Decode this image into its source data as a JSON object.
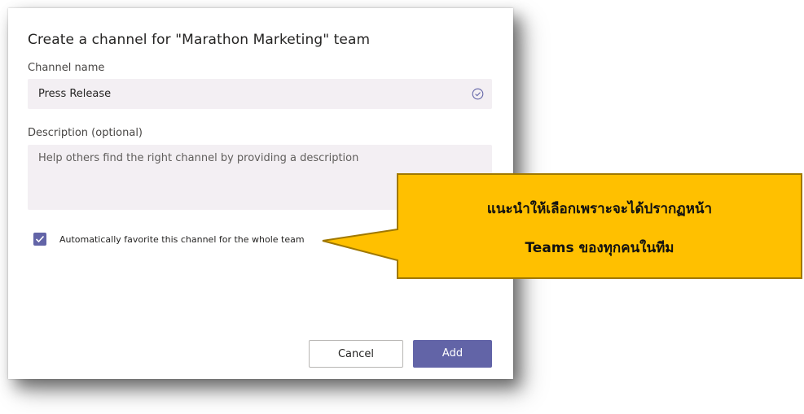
{
  "dialog": {
    "title": "Create a channel for \"Marathon Marketing\" team",
    "channel_name_label": "Channel name",
    "channel_name_value": "Press Release",
    "description_label": "Description (optional)",
    "description_placeholder": "Help others find the right channel by providing a description",
    "favorite_checkbox_checked": true,
    "favorite_label": "Automatically favorite this channel for the whole team",
    "cancel_label": "Cancel",
    "add_label": "Add"
  },
  "callout": {
    "line1": "แนะนำให้เลือกเพราะจะได้ปรากฏหน้า",
    "line2": "Teams ของทุกคนในทีม",
    "fill_color": "#ffc000",
    "border_color": "#b8860b"
  },
  "colors": {
    "accent": "#6264a7",
    "field_bg": "#f3eff3"
  }
}
